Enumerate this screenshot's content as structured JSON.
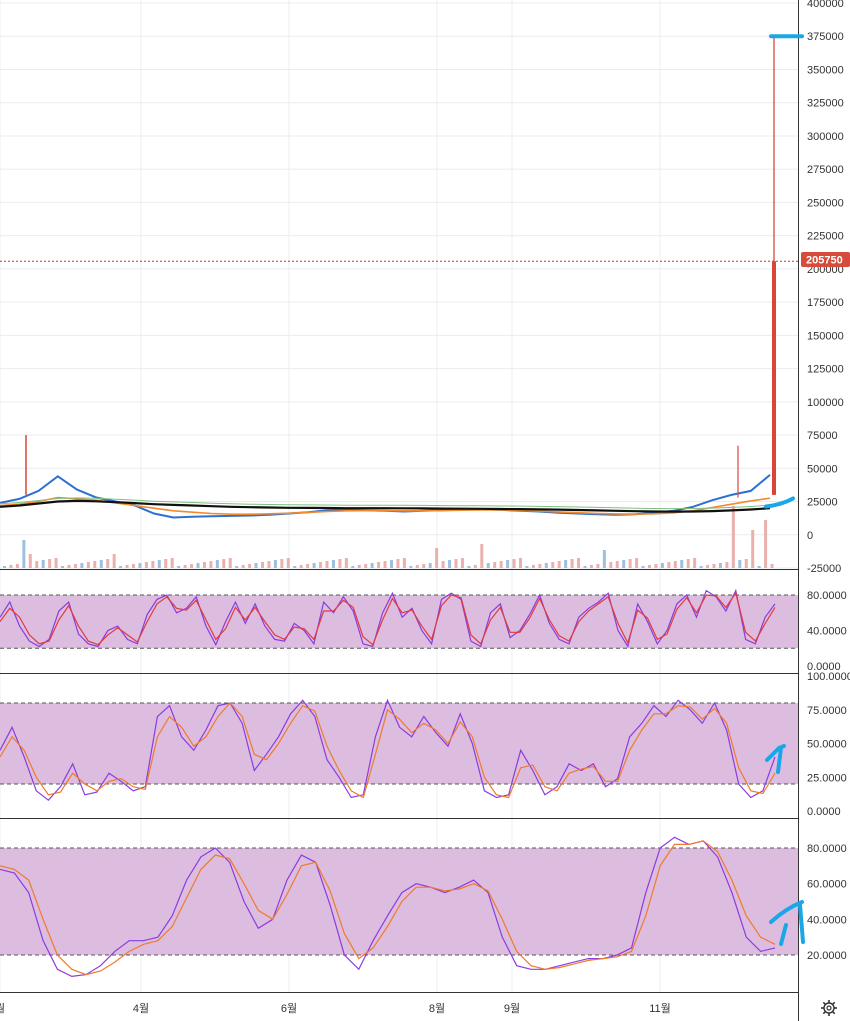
{
  "colors": {
    "grid": "#e8ecf0",
    "band_fill": "#dcbde0",
    "band_border": "#555555",
    "bull": "#26a69a",
    "candle_up": "#2e6fd0",
    "candle_down": "#d9453a",
    "volume_up": "#9dbfe0",
    "volume_down": "#eab0ac",
    "price_tag_bg": "#d54c3c",
    "price_line": "#c0392b",
    "ma_orange": "#f28a30",
    "ma_black": "#111111",
    "ma_green": "#80c080",
    "osc_k": "#8a3ce0",
    "osc_d": "#f07a2a",
    "osc_red": "#e23b3b",
    "annotation": "#1aa7e8",
    "axis_border": "#333333"
  },
  "icons": {
    "settings": "gear-icon"
  },
  "last_price_label": "205750",
  "chart_data": [
    {
      "type": "line",
      "name": "price-panel",
      "y_ticks": [
        "400000",
        "375000",
        "350000",
        "325000",
        "300000",
        "275000",
        "250000",
        "225000",
        "200000",
        "175000",
        "150000",
        "125000",
        "100000",
        "75000",
        "50000",
        "25000",
        "0",
        "-25000"
      ],
      "ylim": [
        -25000,
        400000
      ],
      "last_price": 205750,
      "spike_high": 375000,
      "x_ticks": [
        "월",
        "4월",
        "6월",
        "8월",
        "9월",
        "11월"
      ],
      "x_tick_positions_index": [
        0,
        0.175,
        0.36,
        0.545,
        0.64,
        0.825
      ],
      "series": [
        {
          "values": [
            24000,
            27000,
            33000,
            44000,
            34000,
            28000,
            25000,
            22000,
            16000,
            13000,
            13500,
            14000,
            14200,
            14500,
            15000,
            16000,
            17000,
            18500,
            19000,
            18500,
            18000,
            17500,
            18000,
            18500,
            19000,
            19200,
            18800,
            18000,
            17500,
            16500,
            16000,
            15500,
            15000,
            15500,
            16500,
            18000,
            21000,
            26000,
            30000,
            33000,
            45000
          ]
        },
        {
          "values": [
            22000,
            23000,
            25000,
            28000,
            27000,
            26000,
            24000,
            22000,
            20000,
            18000,
            17000,
            16000,
            15500,
            15500,
            15800,
            16200,
            16800,
            17500,
            18000,
            18200,
            18200,
            18000,
            18000,
            18200,
            18500,
            18700,
            18600,
            18300,
            17800,
            17200,
            16600,
            16100,
            15700,
            15500,
            15800,
            16500,
            18000,
            20500,
            23000,
            25500,
            27500
          ]
        },
        {
          "values": [
            21000,
            22000,
            23500,
            25000,
            25500,
            25200,
            24500,
            23800,
            23000,
            22500,
            22000,
            21500,
            21000,
            20700,
            20500,
            20300,
            20200,
            20100,
            20000,
            20000,
            20000,
            19900,
            19800,
            19700,
            19600,
            19500,
            19400,
            19300,
            19100,
            18900,
            18600,
            18300,
            18000,
            17700,
            17500,
            17400,
            17500,
            17800,
            18300,
            19000,
            20000
          ]
        }
      ],
      "annotations": {
        "hline_value": 375000,
        "arrow_value": 25000
      }
    },
    {
      "type": "line",
      "name": "oscillator-1",
      "y_ticks": [
        "80.0000",
        "40.0000",
        "0.0000"
      ],
      "ylim": [
        0,
        90
      ],
      "band": [
        20,
        80
      ],
      "series": [
        {
          "values": [
            55,
            72,
            45,
            28,
            22,
            30,
            62,
            72,
            36,
            25,
            22,
            40,
            45,
            30,
            25,
            58,
            75,
            80,
            60,
            65,
            78,
            45,
            24,
            50,
            72,
            48,
            70,
            45,
            30,
            28,
            48,
            40,
            25,
            72,
            60,
            78,
            62,
            25,
            22,
            60,
            82,
            55,
            65,
            40,
            25,
            75,
            82,
            75,
            28,
            22,
            60,
            70,
            32,
            40,
            58,
            80,
            48,
            30,
            25,
            55,
            65,
            72,
            82,
            40,
            22,
            70,
            50,
            25,
            40,
            70,
            80,
            55,
            85,
            78,
            62,
            85,
            30,
            25,
            55,
            70
          ]
        },
        {
          "values": [
            50,
            65,
            55,
            35,
            25,
            28,
            52,
            68,
            45,
            28,
            24,
            35,
            43,
            35,
            27,
            50,
            70,
            78,
            65,
            63,
            74,
            52,
            30,
            42,
            66,
            52,
            66,
            50,
            35,
            30,
            44,
            42,
            30,
            62,
            62,
            74,
            66,
            33,
            24,
            52,
            76,
            60,
            63,
            45,
            30,
            68,
            80,
            77,
            35,
            25,
            52,
            66,
            38,
            38,
            54,
            76,
            52,
            34,
            28,
            50,
            62,
            70,
            78,
            48,
            26,
            63,
            54,
            30,
            36,
            64,
            77,
            60,
            80,
            79,
            66,
            82,
            38,
            28,
            48,
            66
          ]
        }
      ]
    },
    {
      "type": "line",
      "name": "oscillator-2",
      "y_ticks": [
        "100.0000",
        "75.0000",
        "50.0000",
        "25.0000",
        "0.0000"
      ],
      "ylim": [
        0,
        100
      ],
      "band": [
        20,
        80
      ],
      "series": [
        {
          "values": [
            45,
            62,
            40,
            15,
            8,
            18,
            35,
            12,
            14,
            28,
            22,
            15,
            18,
            70,
            78,
            55,
            45,
            60,
            78,
            80,
            65,
            30,
            42,
            55,
            72,
            82,
            70,
            38,
            25,
            10,
            12,
            55,
            82,
            62,
            55,
            70,
            58,
            48,
            72,
            50,
            15,
            10,
            12,
            45,
            30,
            12,
            18,
            35,
            30,
            35,
            18,
            24,
            55,
            65,
            78,
            70,
            82,
            75,
            65,
            80,
            60,
            20,
            10,
            15,
            40
          ]
        },
        {
          "values": [
            40,
            55,
            45,
            25,
            12,
            14,
            28,
            20,
            15,
            22,
            24,
            18,
            16,
            55,
            70,
            62,
            48,
            55,
            70,
            80,
            70,
            42,
            38,
            50,
            65,
            78,
            74,
            48,
            30,
            15,
            10,
            42,
            75,
            68,
            58,
            65,
            60,
            50,
            66,
            55,
            25,
            12,
            10,
            32,
            34,
            18,
            15,
            28,
            31,
            33,
            22,
            22,
            45,
            60,
            72,
            72,
            78,
            77,
            68,
            76,
            65,
            32,
            15,
            13,
            28
          ]
        }
      ]
    },
    {
      "type": "line",
      "name": "oscillator-3",
      "y_ticks": [
        "80.0000",
        "60.0000",
        "40.0000",
        "20.0000"
      ],
      "ylim": [
        0,
        95
      ],
      "band": [
        20,
        80
      ],
      "series": [
        {
          "values": [
            68,
            66,
            55,
            28,
            12,
            8,
            9,
            14,
            22,
            28,
            28,
            30,
            42,
            62,
            75,
            80,
            72,
            50,
            35,
            40,
            62,
            76,
            72,
            48,
            20,
            12,
            28,
            42,
            55,
            60,
            58,
            55,
            58,
            62,
            55,
            30,
            14,
            12,
            12,
            14,
            16,
            18,
            18,
            20,
            24,
            55,
            80,
            86,
            82,
            84,
            75,
            55,
            30,
            22,
            24
          ]
        },
        {
          "values": [
            70,
            68,
            62,
            40,
            20,
            12,
            9,
            11,
            16,
            22,
            26,
            28,
            36,
            52,
            68,
            76,
            74,
            60,
            45,
            40,
            54,
            70,
            72,
            56,
            32,
            18,
            24,
            36,
            50,
            58,
            58,
            56,
            57,
            60,
            56,
            40,
            22,
            14,
            12,
            13,
            15,
            17,
            18,
            19,
            22,
            42,
            70,
            82,
            82,
            84,
            78,
            62,
            42,
            30,
            26
          ]
        }
      ]
    }
  ]
}
